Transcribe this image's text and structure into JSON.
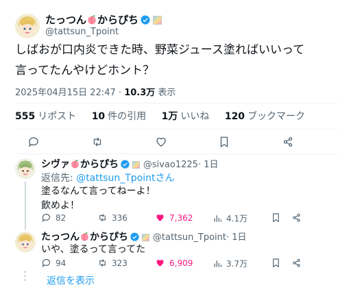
{
  "main": {
    "user": {
      "name": "たっつん",
      "name_suffix": "からぴち",
      "handle": "@tattsun_Tpoint"
    },
    "text_line1": "しばおが口内炎できた時、野菜ジュース塗ればいいって",
    "text_line2": "言ってたんやけどホント？",
    "timestamp": "2025年04月15日 22:47",
    "separator": "·",
    "views": "10.3万",
    "views_label": "表示",
    "stats": {
      "retweets_count": "555",
      "retweets_label": "リポスト",
      "quotes_count": "10",
      "quotes_label": "件の引用",
      "likes_count": "1万",
      "likes_label": "いいね",
      "bookmarks_count": "120",
      "bookmarks_label": "ブックマーク"
    }
  },
  "reply1": {
    "name": "シヴァ",
    "name_suffix": "からぴち",
    "handle": "@sivao1225",
    "time": "· 1日",
    "reply_to_label": "返信先: ",
    "reply_to_handle": "@tattsun_Tpoint",
    "reply_to_suffix": "さん",
    "text_line1": "塗るなんて言ってねーよ！",
    "text_line2": "飲めよ！",
    "replies": "82",
    "retweets": "336",
    "likes": "7,362",
    "views": "4.1万",
    "liked": true
  },
  "reply2": {
    "name": "たっつん",
    "name_suffix": "からぴち",
    "handle": "@tattsun_Tpoint",
    "time": "· 1日",
    "text": "いや、塗るって言ってた",
    "replies": "94",
    "retweets": "323",
    "likes": "6,909",
    "views": "3.7万",
    "liked": true
  },
  "show_replies": "返信を表示",
  "colors": {
    "accent": "#1d9bf0",
    "like": "#f91880",
    "muted": "#536471",
    "text": "#0f1419"
  }
}
